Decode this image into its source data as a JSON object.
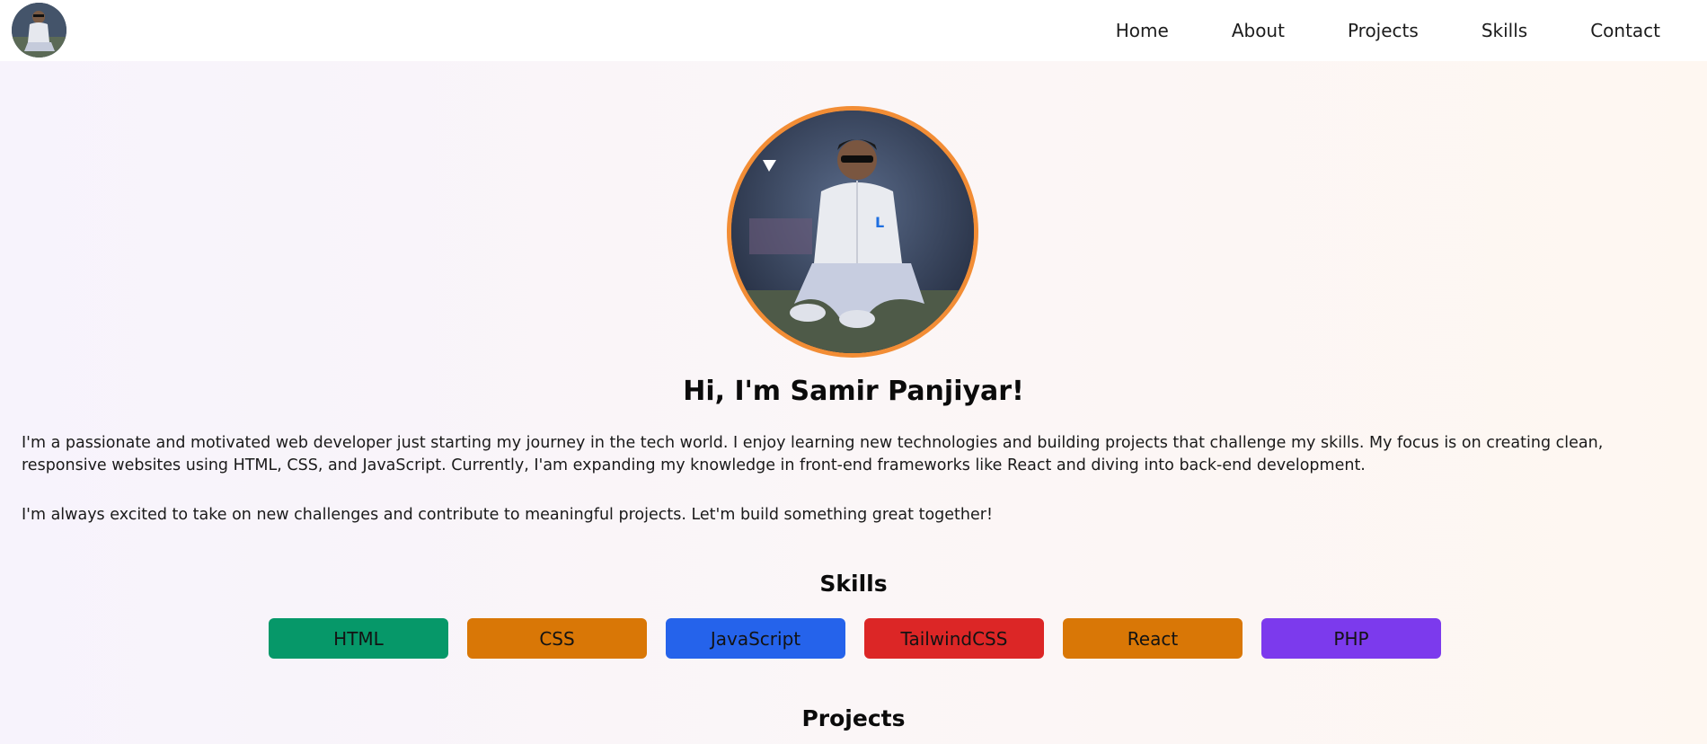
{
  "nav": {
    "links": [
      "Home",
      "About",
      "Projects",
      "Skills",
      "Contact"
    ]
  },
  "hero": {
    "title": "Hi, I'm Samir Panjiyar!",
    "bio": [
      "I'm a passionate and motivated web developer just starting my journey in the tech world. I enjoy learning new technologies and building projects that challenge my skills. My focus is on creating clean, responsive websites using HTML, CSS, and JavaScript. Currently, I'am expanding my knowledge in front-end frameworks like React and diving into back-end development.",
      "I'm always excited to take on new challenges and contribute to meaningful projects. Let'm build something great together!"
    ]
  },
  "skills": {
    "title": "Skills",
    "items": [
      {
        "label": "HTML",
        "color": "#069869"
      },
      {
        "label": "CSS",
        "color": "#d97706"
      },
      {
        "label": "JavaScript",
        "color": "#2563eb"
      },
      {
        "label": "TailwindCSS",
        "color": "#dc2626"
      },
      {
        "label": "React",
        "color": "#d97706"
      },
      {
        "label": "PHP",
        "color": "#7c3aed"
      }
    ]
  },
  "projects": {
    "title": "Projects"
  },
  "colors": {
    "accent_ring": "#f28d35"
  }
}
